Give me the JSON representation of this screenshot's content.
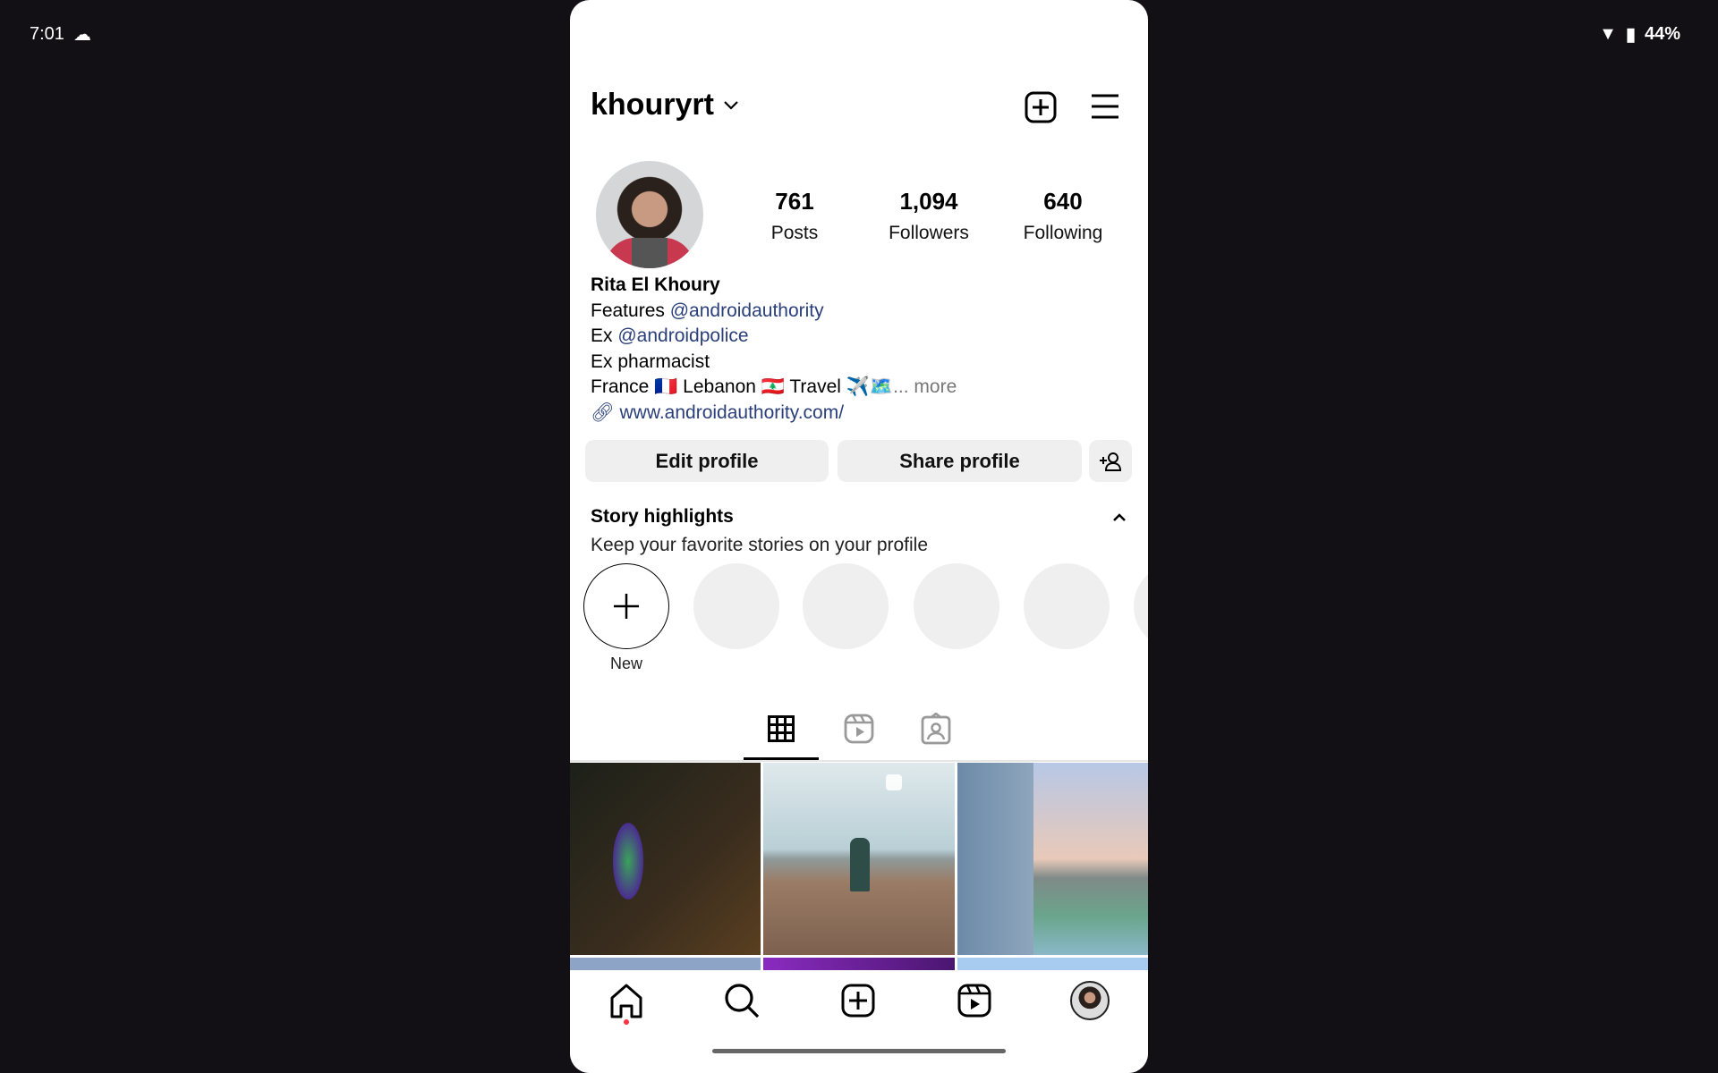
{
  "status_bar": {
    "time": "7:01",
    "battery": "44%"
  },
  "header": {
    "username": "khouryrt"
  },
  "stats": [
    {
      "value": "761",
      "label": "Posts"
    },
    {
      "value": "1,094",
      "label": "Followers"
    },
    {
      "value": "640",
      "label": "Following"
    }
  ],
  "bio": {
    "name": "Rita El Khoury",
    "line1_prefix": "Features ",
    "line1_link": "@androidauthority",
    "line2_prefix": "Ex ",
    "line2_link": "@androidpolice",
    "line3": "Ex pharmacist",
    "line4": "France 🇫🇷 Lebanon 🇱🇧 Travel ✈️🗺️",
    "more": "... more",
    "website": "www.androidauthority.com/"
  },
  "buttons": {
    "edit": "Edit profile",
    "share": "Share profile"
  },
  "highlights": {
    "title": "Story highlights",
    "subtitle": "Keep your favorite stories on your profile",
    "new_label": "New"
  },
  "colors": {
    "link": "#2a3f7a",
    "notification_dot": "#ff3040"
  }
}
